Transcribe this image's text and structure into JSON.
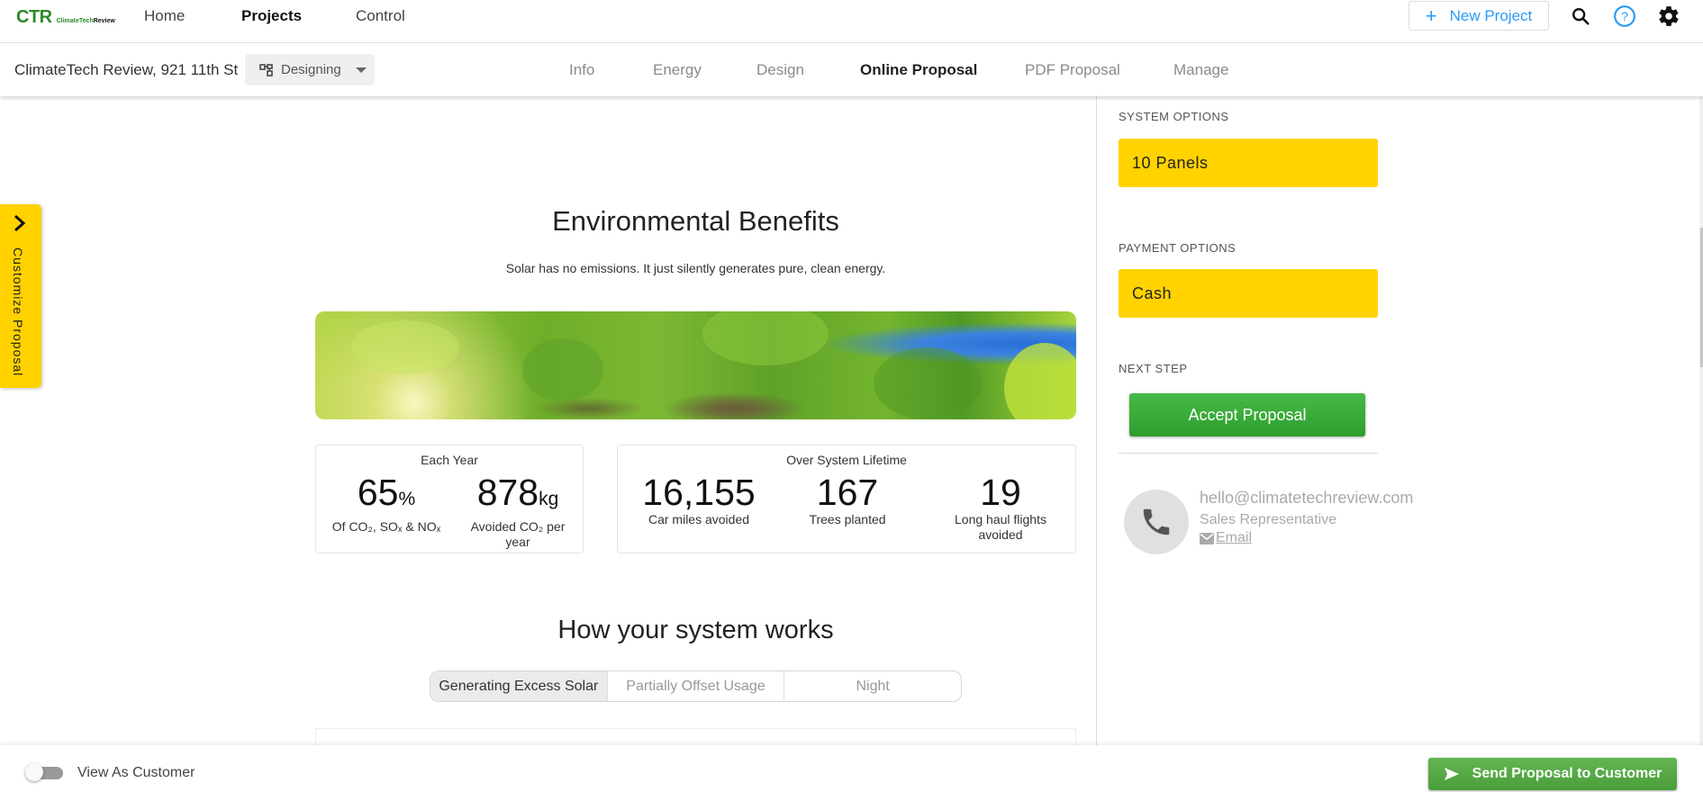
{
  "app": {
    "logo_big": "CTR",
    "logo_small_green": "ClimateTech",
    "logo_small_dark": "Review"
  },
  "topnav": {
    "links": [
      {
        "label": "Home",
        "active": false
      },
      {
        "label": "Projects",
        "active": true
      },
      {
        "label": "Control",
        "active": false
      }
    ],
    "new_project_label": "New Project",
    "new_project_icon": "plus-icon",
    "icons": [
      "search-icon",
      "help-icon",
      "gear-icon"
    ]
  },
  "subbar": {
    "project_name": "ClimateTech Review, 921 11th St",
    "status": "Designing",
    "tabs": [
      {
        "label": "Info",
        "active": false
      },
      {
        "label": "Energy",
        "active": false
      },
      {
        "label": "Design",
        "active": false
      },
      {
        "label": "Online Proposal",
        "active": true
      },
      {
        "label": "PDF Proposal",
        "active": false
      },
      {
        "label": "Manage",
        "active": false
      }
    ]
  },
  "customize_tab": {
    "label": "Customize Proposal"
  },
  "environmental": {
    "title": "Environmental Benefits",
    "subtitle": "Solar has no emissions. It just silently generates pure, clean energy.",
    "each_year": {
      "title": "Each Year",
      "stats": [
        {
          "value": "65",
          "unit": "%",
          "label": "Of CO₂, SOₓ & NOₓ"
        },
        {
          "value": "878",
          "unit": "kg",
          "label": "Avoided CO₂ per year"
        }
      ]
    },
    "lifetime": {
      "title": "Over System Lifetime",
      "stats": [
        {
          "value": "16,155",
          "label": "Car miles avoided"
        },
        {
          "value": "167",
          "label": "Trees planted"
        },
        {
          "value": "19",
          "label": "Long haul flights avoided"
        }
      ]
    }
  },
  "how_it_works": {
    "title": "How your system works",
    "options": [
      {
        "label": "Generating Excess Solar",
        "active": true
      },
      {
        "label": "Partially Offset Usage",
        "active": false
      },
      {
        "label": "Night",
        "active": false
      }
    ]
  },
  "right_panel": {
    "system_options_label": "SYSTEM OPTIONS",
    "system_option": "10 Panels",
    "payment_options_label": "PAYMENT OPTIONS",
    "payment_option": "Cash",
    "next_step_label": "NEXT STEP",
    "accept_label": "Accept Proposal",
    "contact": {
      "email": "hello@climatetechreview.com",
      "role": "Sales Representative",
      "link_label": "Email"
    }
  },
  "footer": {
    "view_as_customer_label": "View As Customer",
    "view_as_customer_on": false,
    "send_label": "Send Proposal to Customer"
  },
  "colors": {
    "accent_yellow": "#ffd200",
    "accept_green": "#3aab3a",
    "send_green": "#56aa46",
    "link_blue": "#2a9af3"
  }
}
